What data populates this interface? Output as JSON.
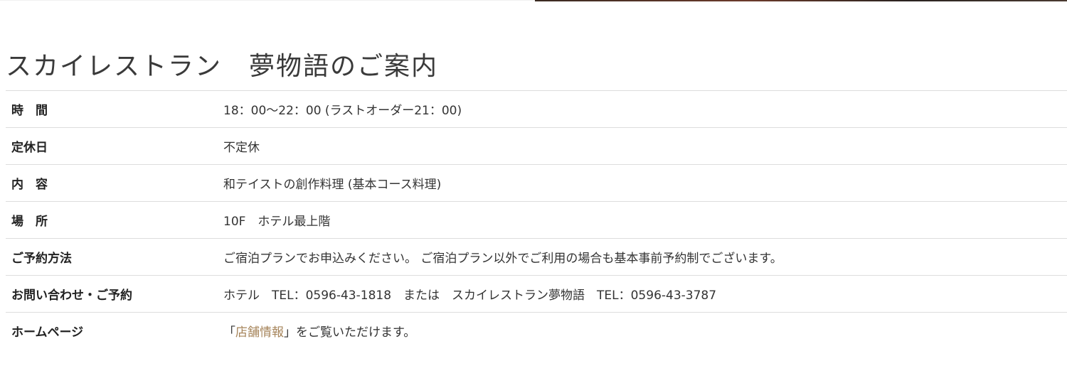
{
  "section": {
    "title": "スカイレストラン　夢物語のご案内"
  },
  "rows": [
    {
      "label": "時　間",
      "value": "18：00〜22：00 (ラストオーダー21：00)"
    },
    {
      "label": "定休日",
      "value": "不定休"
    },
    {
      "label": "内　容",
      "value": "和テイストの創作料理 (基本コース料理)"
    },
    {
      "label": "場　所",
      "value": "10F　ホテル最上階"
    },
    {
      "label": "ご予約方法",
      "value": "ご宿泊プランでお申込みください。 ご宿泊プラン以外でご利用の場合も基本事前予約制でございます。"
    },
    {
      "label": "お問い合わせ・ご予約",
      "value": "ホテル　TEL：0596-43-1818　または　スカイレストラン夢物語　TEL：0596-43-3787"
    },
    {
      "label": "ホームページ",
      "value_prefix": "「",
      "link_text": "店舗情報",
      "value_suffix": "」をご覧いただけます。"
    }
  ],
  "colors": {
    "link": "#a6845a",
    "divider": "#dddddd",
    "text": "#333333"
  }
}
